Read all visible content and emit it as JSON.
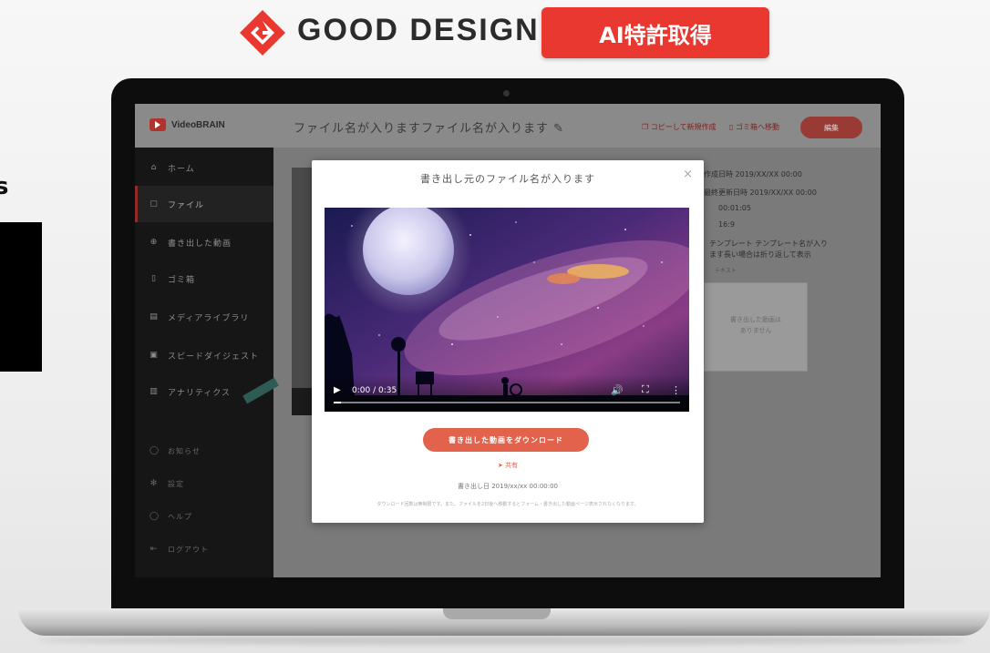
{
  "banner": {
    "gd_text": "GOOD DESIGN",
    "ai_badge": "AI特許取得",
    "edge_char": "s"
  },
  "app": {
    "brand": "VideoBRAIN",
    "file_title": "ファイル名が入りますファイル名が入ります ✎",
    "copy_link": "コピーして新規作成",
    "trash_link": "ゴミ箱へ移動",
    "edit_button": "編集"
  },
  "sidebar": {
    "items": [
      {
        "icon": "⌂",
        "label": "ホーム"
      },
      {
        "icon": "▢",
        "label": "ファイル"
      },
      {
        "icon": "⊕",
        "label": "書き出した動画"
      },
      {
        "icon": "▯",
        "label": "ゴミ箱"
      },
      {
        "icon": "▤",
        "label": "メディアライブラリ"
      },
      {
        "icon": "▣",
        "label": "スピードダイジェスト"
      },
      {
        "icon": "▥",
        "label": "アナリティクス"
      }
    ],
    "bottom": [
      {
        "icon": "◯",
        "label": "お知らせ"
      },
      {
        "icon": "✻",
        "label": "設定"
      },
      {
        "icon": "◯",
        "label": "ヘルプ"
      },
      {
        "icon": "⇤",
        "label": "ログアウト"
      }
    ]
  },
  "meta": {
    "created": "作成日時 2019/XX/XX 00:00",
    "updated": "最終更新日時 2019/XX/XX 00:00",
    "duration": "00:01:05",
    "ratio": "16:9",
    "template_line1": "テンプレート テンプレート名が入り",
    "template_line2": "ます長い場合は折り返して表示",
    "note": "テキスト",
    "preview_text_1": "書き出した動画は",
    "preview_text_2": "ありません"
  },
  "modal": {
    "title": "書き出し元のファイル名が入ります",
    "close": "×",
    "video": {
      "play": "▶",
      "time": "0:00 / 0:35",
      "progress": 0.02,
      "volume_icon": "🔊",
      "fullscreen_icon": "⛶",
      "more_icon": "⋮"
    },
    "download_button": "書き出した動画をダウンロード",
    "share_link": "➤ 共有",
    "export_date": "書き出し日 2019/xx/xx 00:00:00",
    "notice": "ダウンロード回数は無制限です。また、ファイルを2日後へ移動するとフォーム・書き出した動画ページ表示されなくなります。"
  }
}
